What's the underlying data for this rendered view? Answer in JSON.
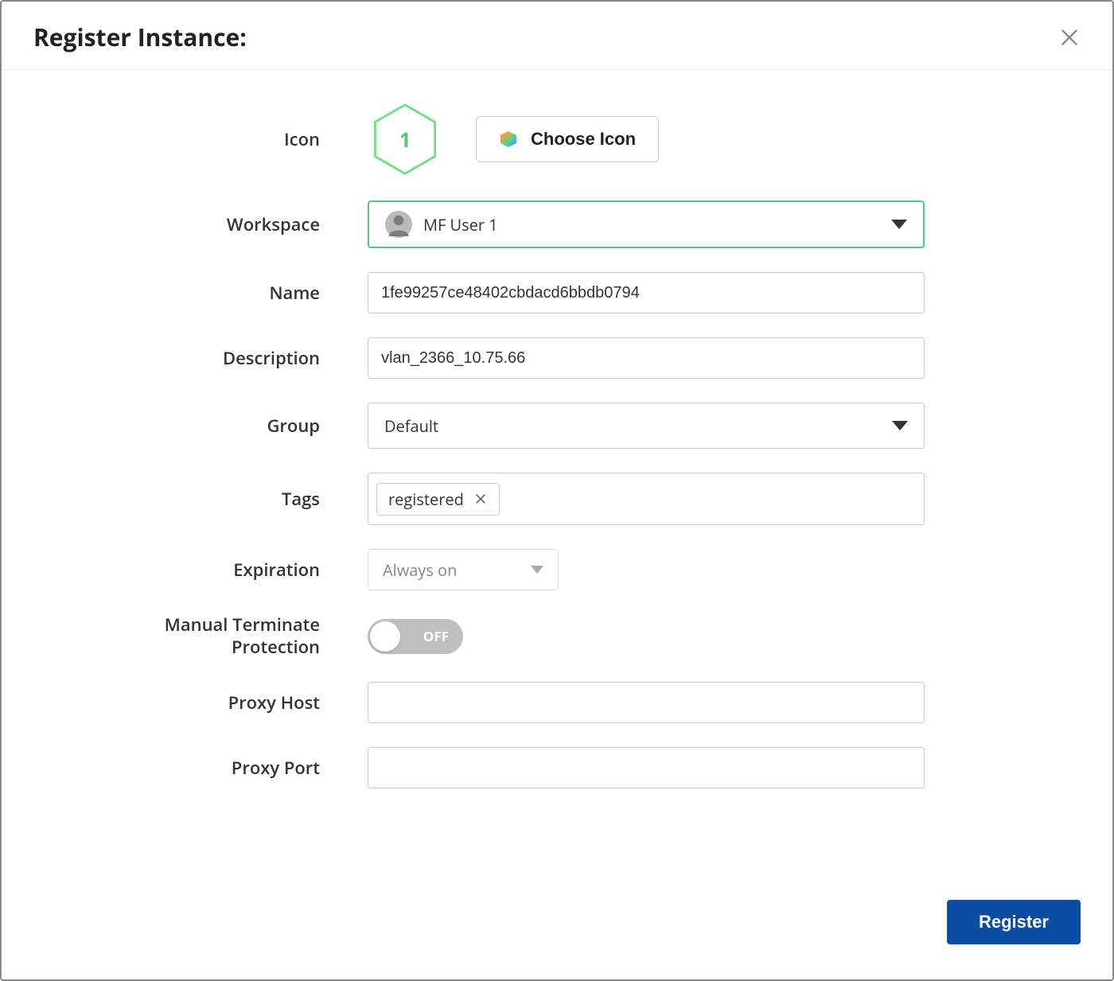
{
  "modal": {
    "title": "Register Instance:"
  },
  "labels": {
    "icon": "Icon",
    "workspace": "Workspace",
    "name": "Name",
    "description": "Description",
    "group": "Group",
    "tags": "Tags",
    "expiration": "Expiration",
    "mtp_line1": "Manual Terminate",
    "mtp_line2": "Protection",
    "proxy_host": "Proxy Host",
    "proxy_port": "Proxy Port"
  },
  "icon": {
    "number": "1",
    "choose_label": "Choose Icon"
  },
  "workspace": {
    "selected": "MF User 1"
  },
  "name": {
    "value": "1fe99257ce48402cbdacd6bbdb0794"
  },
  "description": {
    "value": "vlan_2366_10.75.66"
  },
  "group": {
    "selected": "Default"
  },
  "tags": {
    "items": [
      {
        "label": "registered"
      }
    ]
  },
  "expiration": {
    "selected": "Always on"
  },
  "mtp": {
    "state": "OFF",
    "on": false
  },
  "proxy_host": {
    "value": ""
  },
  "proxy_port": {
    "value": ""
  },
  "footer": {
    "register_label": "Register"
  },
  "colors": {
    "accent_green": "#4ec97e",
    "primary_blue": "#0b4da2"
  }
}
